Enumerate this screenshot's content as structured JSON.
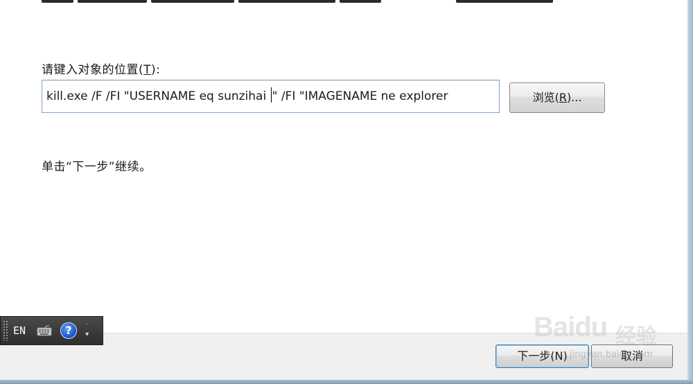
{
  "dialog": {
    "location_label_prefix": "请键入对象的位置(",
    "location_label_mnemonic": "T",
    "location_label_suffix": "):",
    "location_value_before_caret": "kill.exe /F /FI \"USERNAME eq sunzihai ",
    "location_value_after_caret": "\" /FI \"IMAGENAME ne explorer",
    "browse_prefix": "浏览(",
    "browse_mnemonic": "R",
    "browse_suffix": ")...",
    "hint": "单击“下一步”继续。",
    "next_label": "下一步(N)",
    "cancel_label": "取消"
  },
  "language_bar": {
    "language": "EN",
    "keyboard_icon": "keyboard-icon",
    "help_icon": "help-icon",
    "help_glyph": "?",
    "options_icon": "options-arrow-icon"
  },
  "watermark": {
    "logo": "Baidu",
    "name": "经验",
    "url": "jingyan.baidu.com"
  },
  "colors": {
    "input_border": "#7ea3c8",
    "default_button_border": "#3c7fb1",
    "language_bar_bg": "#3a3a3a",
    "help_blue": "#1b4fc4"
  }
}
